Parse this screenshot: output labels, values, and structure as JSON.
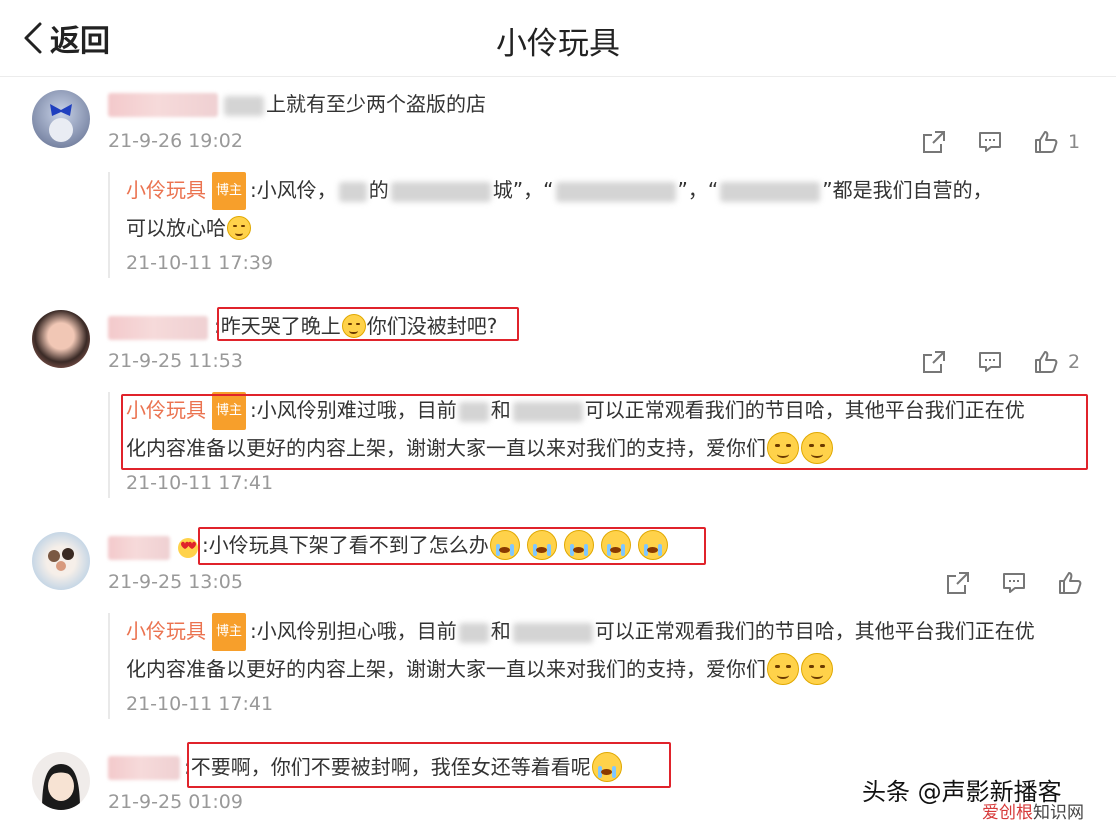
{
  "header": {
    "back_label": "返回",
    "title": "小伶玩具"
  },
  "author": {
    "name": "小伶玩具",
    "badge": "博主"
  },
  "comments": [
    {
      "text": "上就有至少两个盗版的店",
      "time": "21-9-26 19:02",
      "likes": "1",
      "reply": {
        "line1_a": ":小风伶，",
        "line1_b": "的",
        "line1_c": "城”，“",
        "line1_d": "”，“",
        "line1_e": "”都是我们自营的，",
        "line2": "可以放心哈",
        "time": "21-10-11 17:39"
      }
    },
    {
      "text_a": "昨天哭了晚上",
      "text_b": "你们没被封吧?",
      "time": "21-9-25 11:53",
      "likes": "2",
      "reply": {
        "line1_a": ":小风伶别难过哦，目前",
        "line1_b": "和",
        "line1_c": "可以正常观看我们的节目哈，其他平台我们正在优",
        "line2": "化内容准备以更好的内容上架，谢谢大家一直以来对我们的支持，爱你们",
        "time": "21-10-11 17:41"
      }
    },
    {
      "text": "小伶玩具下架了看不到了怎么办",
      "time": "21-9-25 13:05",
      "reply": {
        "line1_a": ":小风伶别担心哦，目前",
        "line1_b": "和",
        "line1_c": "可以正常观看我们的节目哈，其他平台我们正在优",
        "line2": "化内容准备以更好的内容上架，谢谢大家一直以来对我们的支持，爱你们",
        "time": "21-10-11 17:41"
      }
    },
    {
      "text": "不要啊，你们不要被封啊，我侄女还等着看呢",
      "time": "21-9-25 01:09"
    }
  ],
  "watermark": {
    "main": "头条 @声影新播客",
    "sub_a": "爱创根",
    "sub_b": "知识网"
  },
  "colors": {
    "author": "#eb7350",
    "badge": "#f79f2b",
    "highlight": "#e0232b",
    "time": "#999999"
  }
}
